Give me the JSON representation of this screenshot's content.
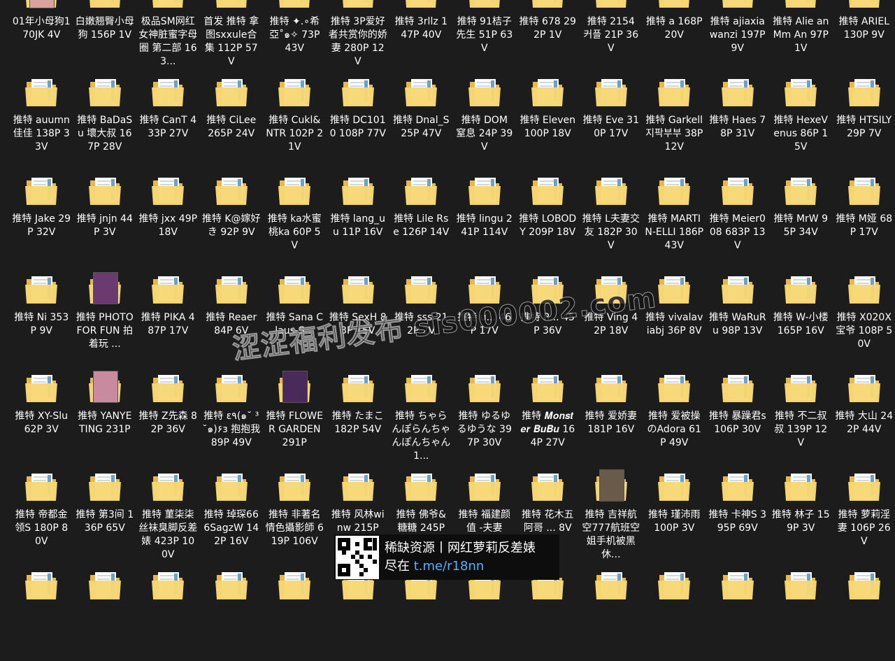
{
  "files": [
    {
      "label": "01年小母狗170JK 4V",
      "thumb": "#d7a39c"
    },
    {
      "label": "白嫩翘臀小母狗 156P 1V"
    },
    {
      "label": "极品SM网红女神脏蜜字母圈 第二部 163..."
    },
    {
      "label": "首发 推特 拿图sxxule合集 112P 57V"
    },
    {
      "label": "推特 ✦.∘希亞˚๑✧ 73P 43V"
    },
    {
      "label": "推特 3P爱好者共赏你的娇妻 280P 12V"
    },
    {
      "label": "推特 3rllz 147P 40V"
    },
    {
      "label": "推特 91桔子先生 51P 63V"
    },
    {
      "label": "推特 678 292P 1V"
    },
    {
      "label": "推特 2154 커플 21P 36V"
    },
    {
      "label": "推特 a 168P 20V"
    },
    {
      "label": "推特 ajiaxiawanzi 197P 9V"
    },
    {
      "label": "推特 Alie an Mm An 97P 1V"
    },
    {
      "label": "推特 ARIEL 130P 9V"
    },
    {
      "label": "推特 auumn佳佳 138P 33V"
    },
    {
      "label": "推特 BaDaSu 壞大叔 167P 28V"
    },
    {
      "label": "推特 CanT 433P 27V"
    },
    {
      "label": "推特 CiLee 265P 24V"
    },
    {
      "label": "推特 Cukl&NTR 102P 21V"
    },
    {
      "label": "推特 DC1010 108P 77V"
    },
    {
      "label": "推特 Dnal_S 25P 47V"
    },
    {
      "label": "推特 DOM 窒息 24P 39V"
    },
    {
      "label": "推特 Eleven 100P 18V"
    },
    {
      "label": "推特 Eve 310P 17V"
    },
    {
      "label": "推特 Garkell 지팍부부 38P 12V"
    },
    {
      "label": "推特 Haes 78P 31V"
    },
    {
      "label": "推特 HexeVenus 86P 15V"
    },
    {
      "label": "推特 HTSILY 29P 7V"
    },
    {
      "label": "推特 Jake 29P 32V"
    },
    {
      "label": "推特 jnjn 44P 3V"
    },
    {
      "label": "推特 jxx 49P 18V"
    },
    {
      "label": "推特 K@嫁好き 92P 9V"
    },
    {
      "label": "推特 ka水蜜桃ka 60P 5V"
    },
    {
      "label": "推特 lang_uu 11P 16V"
    },
    {
      "label": "推特 Lile Rse 126P 14V"
    },
    {
      "label": "推特 lingu 241P 114V"
    },
    {
      "label": "推特 LOBODY 209P 18V"
    },
    {
      "label": "推特 L夫妻交友 182P 30V"
    },
    {
      "label": "推特 MARTIN-ELLI 186P 43V"
    },
    {
      "label": "推特 Meier008 683P 13V"
    },
    {
      "label": "推特 MrW 95P 34V"
    },
    {
      "label": "推特 M娅 68P 17V"
    },
    {
      "label": "推特 Ni 353P 9V"
    },
    {
      "label": "推特 PHOTO FOR FUN 拍着玩 ...",
      "thumb": "#6b3a6e"
    },
    {
      "label": "推特 PIKA 487P 17V"
    },
    {
      "label": "推特 Reaer 84P 6V"
    },
    {
      "label": "推特 Sana Claus-S..."
    },
    {
      "label": "推特 SexH 83P 15V"
    },
    {
      "label": "推特 sss 212P 2V"
    },
    {
      "label": "推特 u... 46P 17V"
    },
    {
      "label": "推特 R... 45P 36V"
    },
    {
      "label": "推特 Ving 42P 18V"
    },
    {
      "label": "推特 vivalaviabj 36P 8V"
    },
    {
      "label": "推特 WaRuRu 98P 13V"
    },
    {
      "label": "推特 W-小楼 165P 16V"
    },
    {
      "label": "推特 X020X宝爷 108P 50V"
    },
    {
      "label": "推特 XY-Slu 62P 3V"
    },
    {
      "label": "推特 YANYETING 231P",
      "thumb": "#c98aa0"
    },
    {
      "label": "推特 Z先森 82P 36V"
    },
    {
      "label": "推特 ε٩(๑˘ ³˘๑)۶з 抱抱我 89P 49V"
    },
    {
      "label": "推特 FLOWER GARDEN 291P",
      "thumb": "#4a2a5a"
    },
    {
      "label": "推特 たまこ 182P 54V"
    },
    {
      "label": "推特 ちゃらんぽらんちゃんぽんちゃん 1..."
    },
    {
      "label": "推特 ゆるゆるゆうな 397P 30V"
    },
    {
      "label": "推特 𝑴𝒐𝒏𝒔𝒕𝒆𝒓 𝑩𝒖𝑩𝒖 164P 27V"
    },
    {
      "label": "推特 爱娇妻 181P 16V"
    },
    {
      "label": "推特 爱被操のAdora 61P 49V"
    },
    {
      "label": "推特 暴躁君s 106P 30V"
    },
    {
      "label": "推特 不二叔叔 139P 12V"
    },
    {
      "label": "推特 大山 242P 44V"
    },
    {
      "label": "推特 帝都金领S 180P 80V"
    },
    {
      "label": "推特 第3间 136P 65V"
    },
    {
      "label": "推特 菫柒柒丝袜臭脚反差婊 423P 100V"
    },
    {
      "label": "推特 琸琛666SagzW 142P 16V"
    },
    {
      "label": "推特 非著名情色攝影師 619P 106V"
    },
    {
      "label": "推特 风林winw 215P"
    },
    {
      "label": "推特 佛爷&糖糖 245P"
    },
    {
      "label": "推特 福建颜值 -夫妻"
    },
    {
      "label": "推特 花木五阿哥 ... 8V"
    },
    {
      "label": "推特 吉祥航空777航班空姐手机被黑 休...",
      "thumb": "#6a5a4a"
    },
    {
      "label": "推特 瑾沛雨 100P 3V"
    },
    {
      "label": "推特 卡神S 395P 69V"
    },
    {
      "label": "推特 林子 159P 3V"
    },
    {
      "label": "推特 萝莉淫妻 106P 26V"
    },
    {
      "label": ""
    },
    {
      "label": ""
    },
    {
      "label": ""
    },
    {
      "label": ""
    },
    {
      "label": ""
    },
    {
      "label": ""
    },
    {
      "label": ""
    },
    {
      "label": ""
    },
    {
      "label": ""
    },
    {
      "label": ""
    },
    {
      "label": ""
    },
    {
      "label": ""
    },
    {
      "label": ""
    },
    {
      "label": ""
    }
  ],
  "watermark": {
    "text": "涩涩福利发布 sis000002.com"
  },
  "banner": {
    "line1": "稀缺资源丨网红萝莉反差婊",
    "line2_prefix": "尽在 ",
    "link": "t.me/r18nn",
    "link_color": "#4fb3ff"
  },
  "colors": {
    "background": "#1c1c1c",
    "folder_back": "#e8b94a",
    "folder_front": "#f7d774"
  }
}
